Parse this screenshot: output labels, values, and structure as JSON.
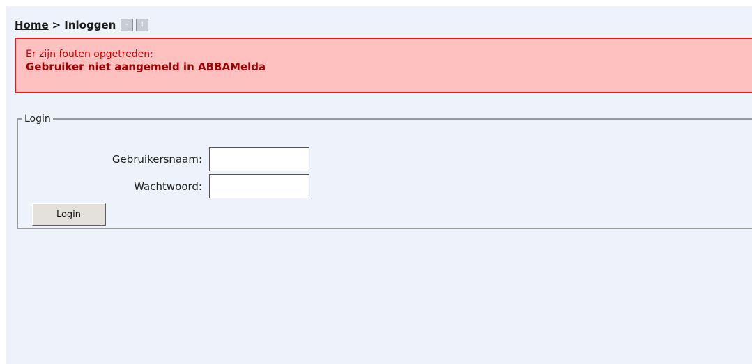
{
  "breadcrumb": {
    "home_label": "Home",
    "separator": ">",
    "current": "Inloggen",
    "zoom_out_label": "-",
    "zoom_in_label": "+"
  },
  "error": {
    "title": "Er zijn fouten opgetreden:",
    "message": "Gebruiker niet aangemeld in ABBAMelda"
  },
  "login": {
    "legend": "Login",
    "username_label": "Gebruikersnaam:",
    "username_value": "",
    "password_label": "Wachtwoord:",
    "password_value": "",
    "button_label": "Login"
  },
  "colors": {
    "page_background": "#eef3fb",
    "error_background": "#ffc0c0",
    "error_border": "#d82020",
    "error_text": "#cc0000"
  }
}
